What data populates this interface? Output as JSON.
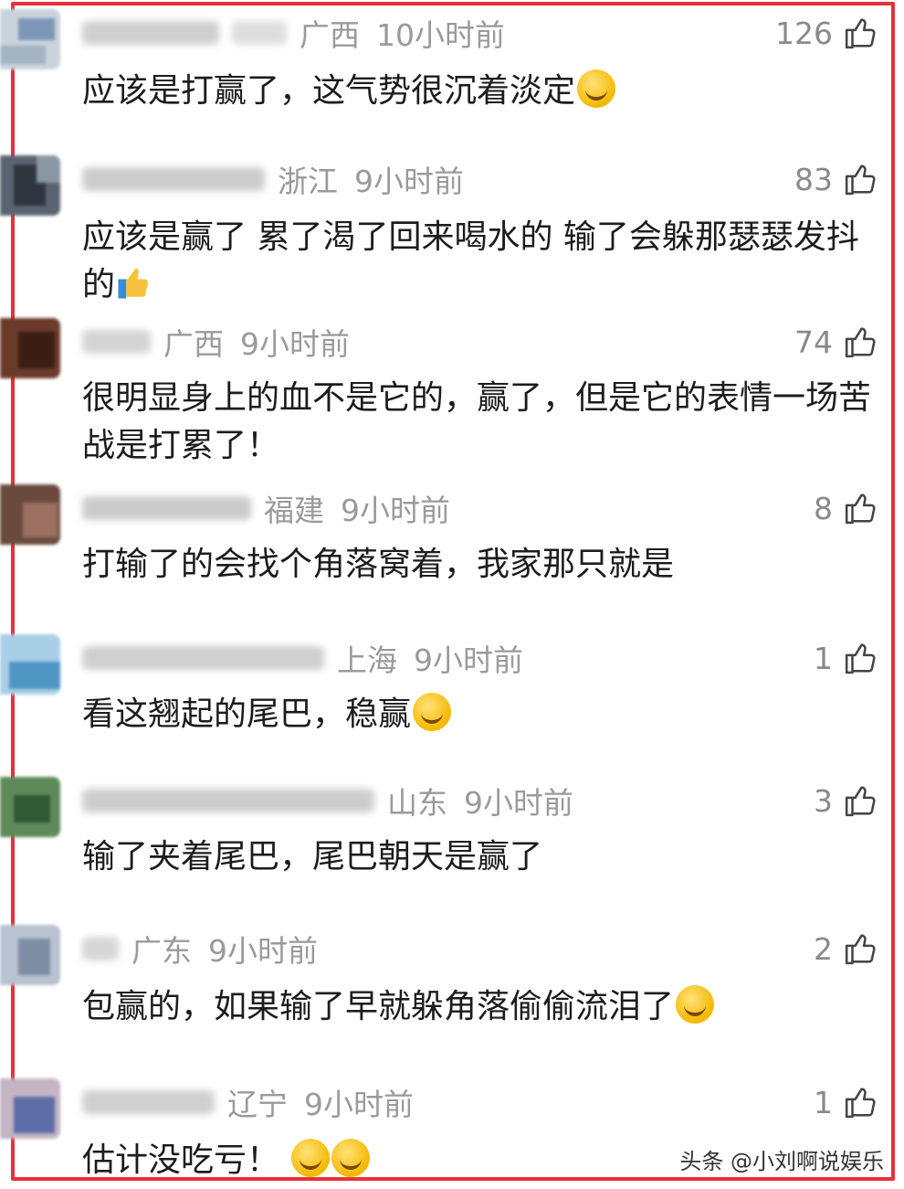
{
  "comments": [
    {
      "location": "广西",
      "time": "10小时前",
      "likes": "126",
      "text": "应该是打赢了，这气势很沉着淡定",
      "emoji": [
        "sob-emoji"
      ]
    },
    {
      "location": "浙江",
      "time": "9小时前",
      "likes": "83",
      "text": "应该是赢了 累了渴了回来喝水的 输了会躲那瑟瑟发抖的",
      "emoji": [
        "thumbs-up-emoji"
      ]
    },
    {
      "location": "广西",
      "time": "9小时前",
      "likes": "74",
      "text": "很明显身上的血不是它的，赢了，但是它的表情一场苦战是打累了！",
      "emoji": []
    },
    {
      "location": "福建",
      "time": "9小时前",
      "likes": "8",
      "text": "打输了的会找个角落窝着，我家那只就是",
      "emoji": []
    },
    {
      "location": "上海",
      "time": "9小时前",
      "likes": "1",
      "text": "看这翘起的尾巴，稳赢",
      "emoji": [
        "grin-emoji"
      ]
    },
    {
      "location": "山东",
      "time": "9小时前",
      "likes": "3",
      "text": "输了夹着尾巴，尾巴朝天是赢了",
      "emoji": []
    },
    {
      "location": "广东",
      "time": "9小时前",
      "likes": "2",
      "text": "包赢的，如果输了早就躲角落偷偷流泪了",
      "emoji": [
        "sob-emoji"
      ]
    },
    {
      "location": "辽宁",
      "time": "9小时前",
      "likes": "1",
      "text": "估计没吃亏！",
      "emoji": [
        "sob-emoji",
        "sob-emoji"
      ]
    }
  ],
  "watermark": "头条 @小刘啊说娱乐"
}
